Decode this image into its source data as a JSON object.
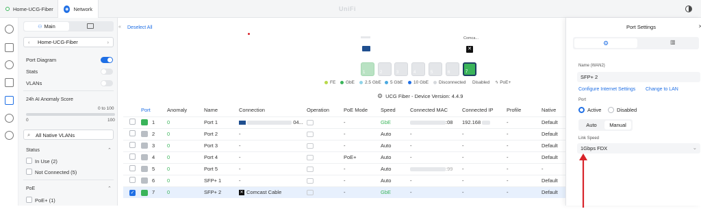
{
  "topbar": {
    "tabs": [
      {
        "label": "Home-UCG-Fiber"
      },
      {
        "label": "Network"
      }
    ],
    "app_title": "UniFi"
  },
  "leftpanel": {
    "tabs": {
      "main": "Main"
    },
    "device_select": "Home-UCG-Fiber",
    "toggles": [
      {
        "label": "Port Diagram",
        "on": true
      },
      {
        "label": "Stats",
        "on": false
      },
      {
        "label": "VLANs",
        "on": false
      }
    ],
    "anomaly": {
      "title": "24h AI Anomaly Score",
      "range_label": "0 to 100",
      "min": "0",
      "max": "100"
    },
    "vlan_select": "All Native VLANs",
    "status": {
      "title": "Status",
      "items": [
        "In Use (2)",
        "Not Connected (5)"
      ]
    },
    "poe": {
      "title": "PoE",
      "items": [
        "PoE+ (1)"
      ]
    }
  },
  "main": {
    "deselect": "Deselect All",
    "device_label": "Comca...",
    "legend": [
      "FE",
      "GbE",
      "2.5 GbE",
      "5 GbE",
      "10 GbE",
      "Disconnected",
      "Disabled",
      "PoE+"
    ],
    "device_version": "UCG Fiber - Device Version: 4.4.9",
    "table": {
      "headers": [
        "Port",
        "Anomaly",
        "Name",
        "Connection",
        "Operation",
        "PoE Mode",
        "Speed",
        "Connected MAC",
        "Connected IP",
        "Profile",
        "Native"
      ],
      "rows": [
        {
          "port": "1",
          "anomaly": "0",
          "name": "Port 1",
          "connection": "04...",
          "poe": "-",
          "speed": "GbE",
          "mac": ":08",
          "ip": "192.168",
          "profile": "-",
          "native": "Default"
        },
        {
          "port": "2",
          "anomaly": "0",
          "name": "Port 2",
          "connection": "-",
          "poe": "-",
          "speed": "Auto",
          "mac": "-",
          "ip": "-",
          "profile": "-",
          "native": "Default"
        },
        {
          "port": "3",
          "anomaly": "0",
          "name": "Port 3",
          "connection": "-",
          "poe": "-",
          "speed": "Auto",
          "mac": "-",
          "ip": "-",
          "profile": "-",
          "native": "Default"
        },
        {
          "port": "4",
          "anomaly": "0",
          "name": "Port 4",
          "connection": "-",
          "poe": "PoE+",
          "speed": "Auto",
          "mac": "-",
          "ip": "-",
          "profile": "-",
          "native": "Default"
        },
        {
          "port": "5",
          "anomaly": "0",
          "name": "Port 5",
          "connection": "-",
          "poe": "-",
          "speed": "Auto",
          "mac": ":99",
          "ip": "-",
          "profile": "-",
          "native": "-"
        },
        {
          "port": "6",
          "anomaly": "0",
          "name": "SFP+ 1",
          "connection": "-",
          "poe": "-",
          "speed": "Auto",
          "mac": "-",
          "ip": "-",
          "profile": "-",
          "native": "Default"
        },
        {
          "port": "7",
          "anomaly": "0",
          "name": "SFP+ 2",
          "connection": "Comcast Cable",
          "poe": "-",
          "speed": "GbE",
          "mac": "-",
          "ip": "-",
          "profile": "-",
          "native": "Default"
        }
      ]
    }
  },
  "settings": {
    "title": "Port Settings",
    "name_label": "Name (WAN2)",
    "name_value": "SFP+ 2",
    "link_internet": "Configure Internet Settings",
    "link_lan": "Change to LAN",
    "port_label": "Port",
    "active": "Active",
    "disabled": "Disabled",
    "auto": "Auto",
    "manual": "Manual",
    "link_speed_label": "Link Speed",
    "link_speed_value": "1Gbps FDX"
  },
  "colors": {
    "accent": "#1f6fe5",
    "green": "#3ab45a",
    "annotation": "#d8232a"
  }
}
